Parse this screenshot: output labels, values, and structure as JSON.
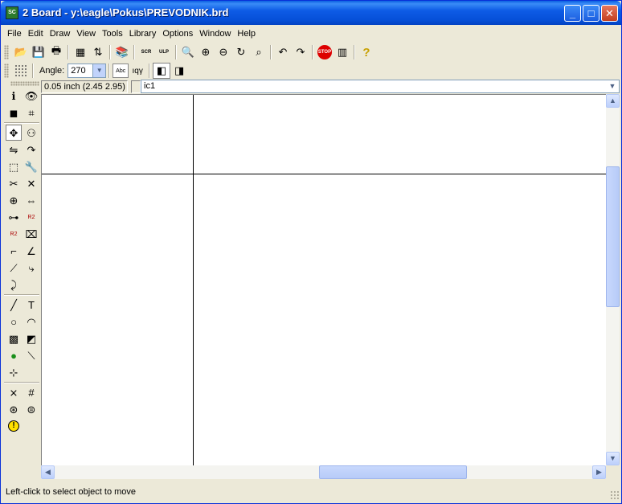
{
  "window": {
    "title": "2 Board - y:\\eagle\\Pokus\\PREVODNIK.brd",
    "app_icon_label": "SC",
    "controls": {
      "minimize": "_",
      "maximize": "□",
      "close": "✕"
    }
  },
  "menu": [
    {
      "label": "File",
      "accel": "F"
    },
    {
      "label": "Edit",
      "accel": "E"
    },
    {
      "label": "Draw",
      "accel": "D"
    },
    {
      "label": "View",
      "accel": "V"
    },
    {
      "label": "Tools",
      "accel": "T"
    },
    {
      "label": "Library",
      "accel": "L"
    },
    {
      "label": "Options",
      "accel": "O"
    },
    {
      "label": "Window",
      "accel": "W"
    },
    {
      "label": "Help",
      "accel": "H"
    }
  ],
  "toolbar_main": [
    {
      "name": "open-icon",
      "glyph": "📂"
    },
    {
      "name": "save-icon",
      "glyph": "💾"
    },
    {
      "name": "print-icon",
      "glyph": "🖶"
    },
    {
      "name": "cam-processor-icon",
      "glyph": "▦"
    },
    {
      "name": "switch-to-schematic-icon",
      "glyph": "⇅"
    },
    {
      "name": "library-icon",
      "glyph": "📚"
    },
    {
      "name": "script-icon",
      "glyph": "SCR"
    },
    {
      "name": "ulp-icon",
      "glyph": "ULP"
    },
    {
      "name": "zoom-fit-icon",
      "glyph": "🔍"
    },
    {
      "name": "zoom-in-icon",
      "glyph": "⊕"
    },
    {
      "name": "zoom-out-icon",
      "glyph": "⊖"
    },
    {
      "name": "redraw-icon",
      "glyph": "↻"
    },
    {
      "name": "zoom-select-icon",
      "glyph": "⌕"
    },
    {
      "name": "undo-icon",
      "glyph": "↶"
    },
    {
      "name": "redo-icon",
      "glyph": "↷"
    },
    {
      "name": "stop-icon",
      "glyph": "STOP"
    },
    {
      "name": "go-icon",
      "glyph": "▥"
    },
    {
      "name": "help-icon",
      "glyph": "?"
    }
  ],
  "toolbar_params": {
    "angle_label": "Angle:",
    "angle_value": "270",
    "mirror_text_icon": "Abc",
    "spin_icon": "ıqγ",
    "layout_icons": [
      "◧",
      "◨"
    ]
  },
  "coords": {
    "position": "0.05 inch (2.45 2.95)",
    "command": "ic1"
  },
  "tools": [
    {
      "name": "info-icon",
      "glyph": "ℹ"
    },
    {
      "name": "show-icon",
      "glyph": "👁"
    },
    {
      "name": "display-layers-icon",
      "glyph": "◼"
    },
    {
      "name": "mark-icon",
      "glyph": "⌗"
    },
    {
      "name": "move-icon",
      "glyph": "✥"
    },
    {
      "name": "copy-icon",
      "glyph": "⚇"
    },
    {
      "name": "mirror-icon",
      "glyph": "⇋"
    },
    {
      "name": "rotate-icon",
      "glyph": "↷"
    },
    {
      "name": "group-icon",
      "glyph": "⬚"
    },
    {
      "name": "change-icon",
      "glyph": "🔧"
    },
    {
      "name": "paste-icon",
      "glyph": "✂"
    },
    {
      "name": "delete-icon",
      "glyph": "✕"
    },
    {
      "name": "add-icon",
      "glyph": "⊕"
    },
    {
      "name": "replace-icon",
      "glyph": "⇔"
    },
    {
      "name": "lock-icon",
      "glyph": "⊶"
    },
    {
      "name": "name-icon",
      "glyph": "R2"
    },
    {
      "name": "value-icon",
      "glyph": "R2"
    },
    {
      "name": "smash-icon",
      "glyph": "⌧"
    },
    {
      "name": "miter-icon",
      "glyph": "⌐"
    },
    {
      "name": "split-icon",
      "glyph": "∠"
    },
    {
      "name": "optimize-icon",
      "glyph": "⟋"
    },
    {
      "name": "route-icon",
      "glyph": "⤷"
    },
    {
      "name": "ripup-icon",
      "glyph": "⤸"
    },
    {
      "name": "wire-icon",
      "glyph": "╱"
    },
    {
      "name": "text-icon",
      "glyph": "T"
    },
    {
      "name": "circle-icon",
      "glyph": "○"
    },
    {
      "name": "arc-icon",
      "glyph": "◠"
    },
    {
      "name": "rect-icon",
      "glyph": "▩"
    },
    {
      "name": "polygon-icon",
      "glyph": "◩"
    },
    {
      "name": "via-icon",
      "glyph": "●"
    },
    {
      "name": "signal-icon",
      "glyph": "⟍"
    },
    {
      "name": "hole-icon",
      "glyph": "⊹"
    },
    {
      "name": "ratsnest-icon",
      "glyph": "⨯"
    },
    {
      "name": "auto-router-icon",
      "glyph": "#"
    },
    {
      "name": "erc-drc-icon",
      "glyph": "⊛"
    },
    {
      "name": "errors-icon",
      "glyph": "⊜"
    },
    {
      "name": "warning-icon",
      "glyph": "!"
    }
  ],
  "status": {
    "text": "Left-click to select object to move"
  },
  "colors": {
    "title_bar": "#0a5fe0",
    "canvas_bg": "#ffffff",
    "crosshair": "#000000",
    "chrome": "#ece9d8"
  }
}
